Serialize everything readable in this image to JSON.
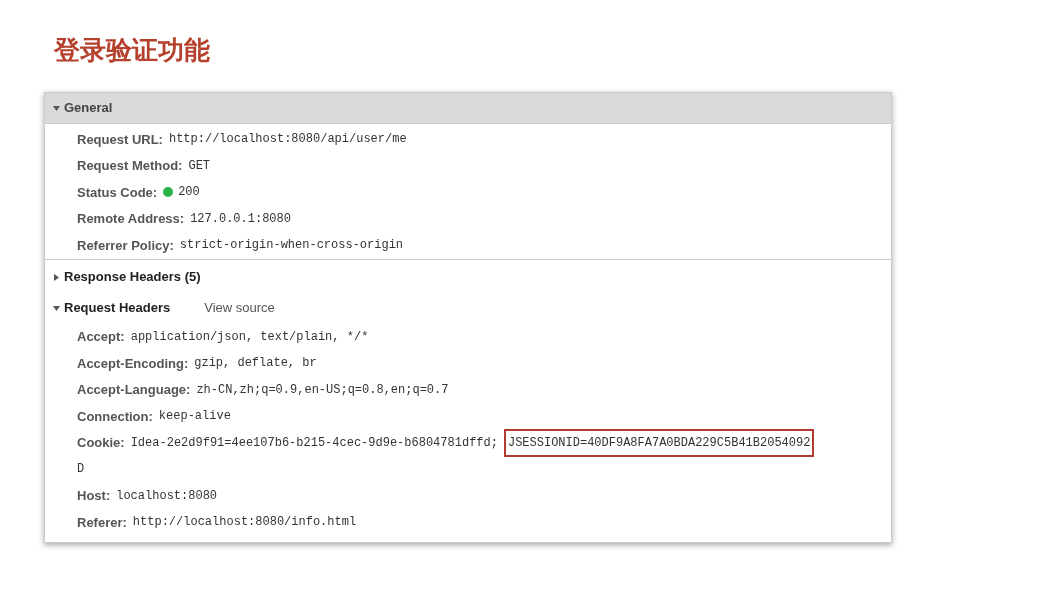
{
  "title": "登录验证功能",
  "sections": [
    {
      "title": "General",
      "expanded": true,
      "kind": "bar",
      "rows": [
        {
          "label": "Request URL:",
          "value": "http://localhost:8080/api/user/me"
        },
        {
          "label": "Request Method:",
          "value": "GET"
        },
        {
          "label": "Status Code:",
          "value": "200",
          "color": "#2bb24c"
        },
        {
          "label": "Remote Address:",
          "value": "127.0.0.1:8080"
        },
        {
          "label": "Referrer Policy:",
          "value": "strict-origin-when-cross-origin"
        }
      ]
    },
    {
      "title": "Response Headers (5)",
      "expanded": false,
      "kind": "plain"
    },
    {
      "title": "Request Headers",
      "expanded": true,
      "kind": "plain",
      "link": "View source",
      "rows": [
        {
          "label": "Accept:",
          "value": "application/json, text/plain, */*"
        },
        {
          "label": "Accept-Encoding:",
          "value": "gzip, deflate, br"
        },
        {
          "label": "Accept-Language:",
          "value": "zh-CN,zh;q=0.9,en-US;q=0.8,en;q=0.7"
        },
        {
          "label": "Connection:",
          "value": "keep-alive"
        },
        {
          "label": "Cookie:",
          "value": "Idea-2e2d9f91=4ee107b6-b215-4cec-9d9e-b6804781dffd;",
          "highlight": "JSESSIONID=40DF9A8FA7A0BDA229C5B41B2054092",
          "continuation": "D"
        },
        {
          "label": "Host:",
          "value": "localhost:8080"
        },
        {
          "label": "Referer:",
          "value": "http://localhost:8080/info.html"
        }
      ]
    }
  ]
}
